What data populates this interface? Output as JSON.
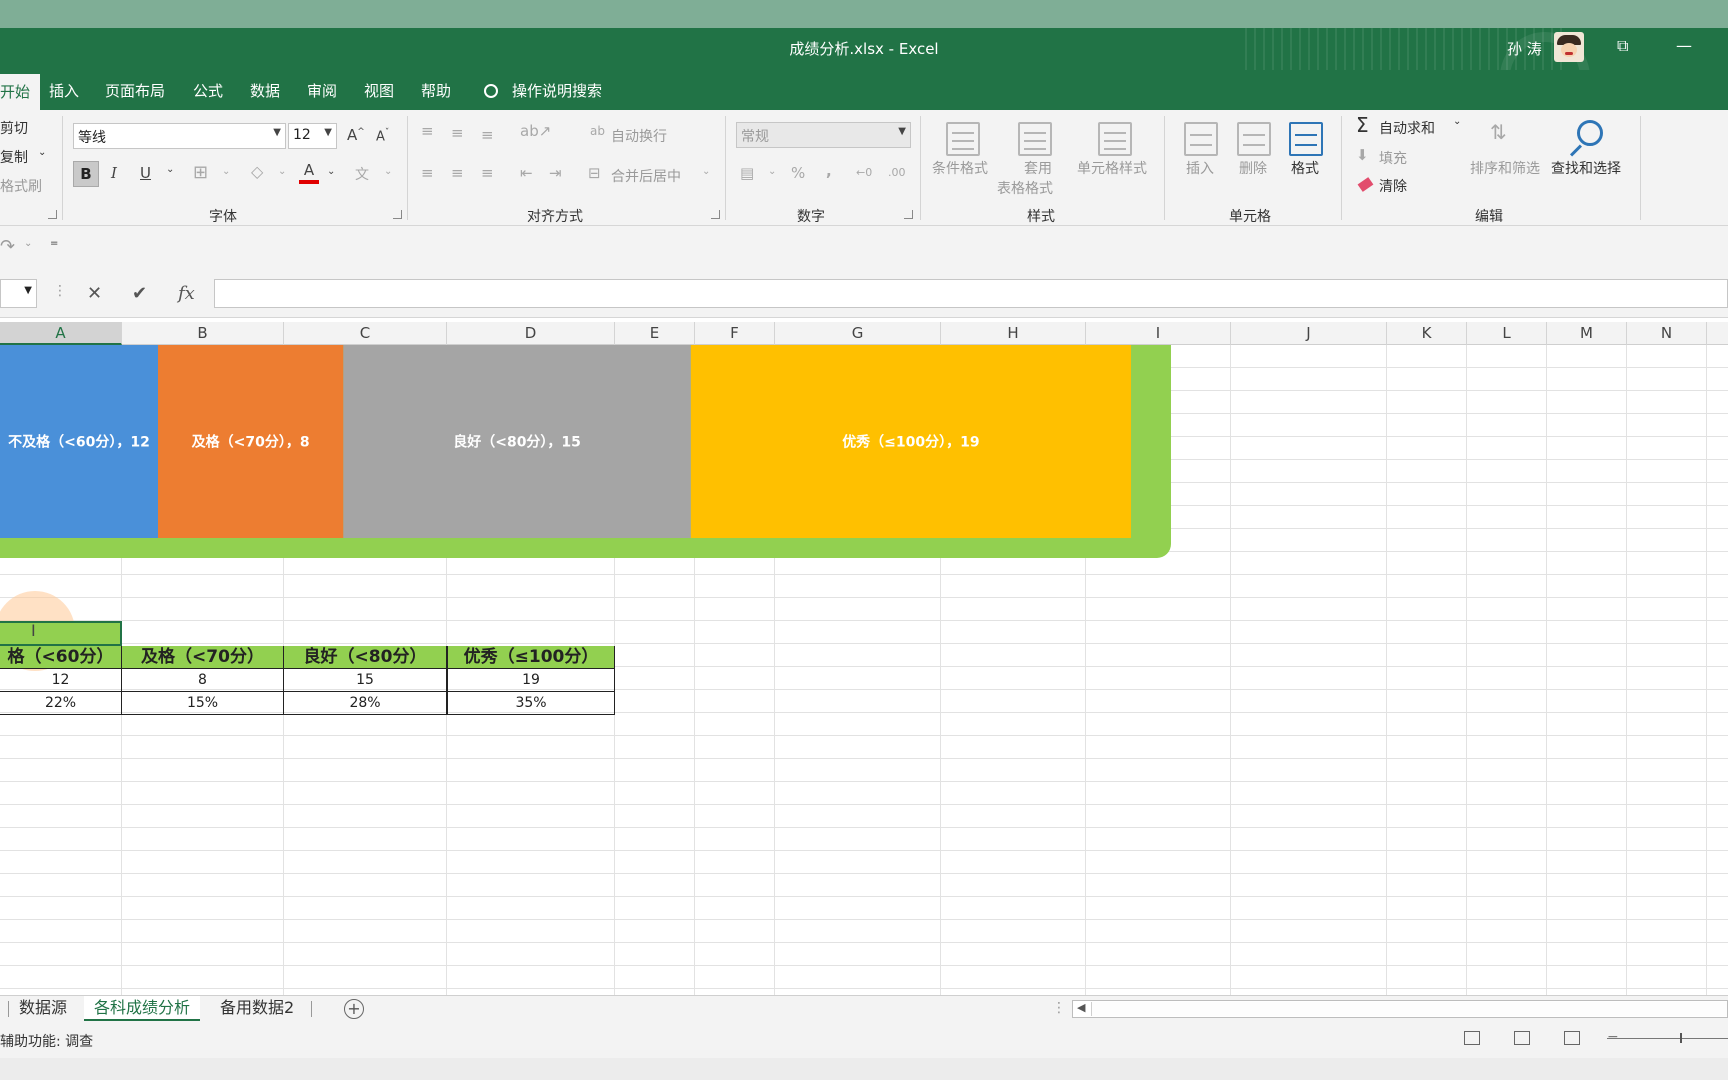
{
  "window": {
    "title": "成绩分析.xlsx  -  Excel",
    "user_name": "孙 涛"
  },
  "ribbon_tabs": [
    {
      "label": "开始",
      "active": true
    },
    {
      "label": "插入"
    },
    {
      "label": "页面布局"
    },
    {
      "label": "公式"
    },
    {
      "label": "数据"
    },
    {
      "label": "审阅"
    },
    {
      "label": "视图"
    },
    {
      "label": "帮助"
    },
    {
      "label": "操作说明搜索"
    }
  ],
  "ribbon": {
    "clipboard": {
      "cut": "剪切",
      "copy": "复制",
      "format_painter": "格式刷"
    },
    "font": {
      "name": "等线",
      "size": "12",
      "group_label": "字体",
      "bold": "B",
      "italic": "I",
      "underline": "U",
      "grow": "A",
      "shrink": "A",
      "font_color_letter": "A",
      "phonetic": "文"
    },
    "alignment": {
      "wrap_text": "自动换行",
      "merge_center": "合并后居中",
      "group_label": "对齐方式"
    },
    "number": {
      "format": "常规",
      "percent": "%",
      "comma": ",",
      "group_label": "数字"
    },
    "styles": {
      "conditional": "条件格式",
      "table_format_line1": "套用",
      "table_format_line2": "表格格式",
      "cell_styles": "单元格样式",
      "group_label": "样式"
    },
    "cells": {
      "insert": "插入",
      "delete": "删除",
      "format": "格式",
      "group_label": "单元格"
    },
    "editing": {
      "autosum": "自动求和",
      "fill": "填充",
      "clear": "清除",
      "sort_filter": "排序和筛选",
      "find_select": "查找和选择",
      "group_label": "编辑"
    }
  },
  "formula_bar": {
    "value": ""
  },
  "columns": [
    "A",
    "B",
    "C",
    "D",
    "E",
    "F",
    "G",
    "H",
    "I",
    "J",
    "K",
    "L",
    "M",
    "N"
  ],
  "chart_data": {
    "type": "bar",
    "orientation": "horizontal-100%-stacked",
    "categories": [
      "不及格（<60分）",
      "及格（<70分）",
      "良好（<80分）",
      "优秀（≤100分）"
    ],
    "values": [
      12,
      8,
      15,
      19
    ],
    "data_labels": [
      "不及格（<60分），12",
      "及格（<70分），8",
      "良好（<80分），15",
      "优秀（≤100分），19"
    ],
    "colors": [
      "#4a90d9",
      "#ed7d31",
      "#a5a5a5",
      "#ffc000"
    ],
    "background": "#92d050",
    "title": "",
    "xlabel": "",
    "ylabel": "",
    "grid": false
  },
  "table": {
    "headers": [
      "格（<60分）",
      "及格（<70分）",
      "良好（<80分）",
      "优秀（≤100分）"
    ],
    "counts": [
      "12",
      "8",
      "15",
      "19"
    ],
    "percents": [
      "22%",
      "15%",
      "28%",
      "35%"
    ]
  },
  "sheets": [
    {
      "label": "数据源"
    },
    {
      "label": "各科成绩分析",
      "active": true
    },
    {
      "label": "备用数据2"
    }
  ],
  "status": {
    "accessibility": "辅助功能: 调查"
  },
  "colors": {
    "excel_green": "#217346",
    "header_fill": "#92d050"
  }
}
